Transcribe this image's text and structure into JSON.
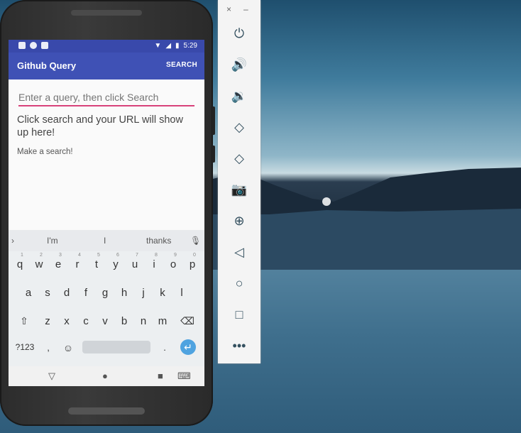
{
  "app": {
    "status_time": "5:29",
    "title": "Github Query",
    "action_label": "SEARCH",
    "query_placeholder": "Enter a query, then click Search",
    "url_message": "Click search and your URL will show up here!",
    "result_message": "Make a search!"
  },
  "keyboard": {
    "suggestions": [
      "I'm",
      "I",
      "thanks"
    ],
    "row1": [
      "q",
      "w",
      "e",
      "r",
      "t",
      "y",
      "u",
      "i",
      "o",
      "p"
    ],
    "row1_hints": [
      "1",
      "2",
      "3",
      "4",
      "5",
      "6",
      "7",
      "8",
      "9",
      "0"
    ],
    "row2": [
      "a",
      "s",
      "d",
      "f",
      "g",
      "h",
      "j",
      "k",
      "l"
    ],
    "row3": [
      "z",
      "x",
      "c",
      "v",
      "b",
      "n",
      "m"
    ],
    "symbols_label": "?123",
    "comma": ",",
    "period": "."
  },
  "emulator_toolbar": {
    "close_label": "×",
    "minimize_label": "–",
    "tools": [
      "power-icon",
      "volume-up-icon",
      "volume-down-icon",
      "rotate-left-icon",
      "rotate-right-icon",
      "camera-icon",
      "zoom-icon",
      "back-icon",
      "home-icon",
      "overview-icon",
      "more-icon"
    ]
  },
  "colors": {
    "primary": "#3f51b5",
    "primary_dark": "#3949ab",
    "accent": "#d8427a"
  }
}
